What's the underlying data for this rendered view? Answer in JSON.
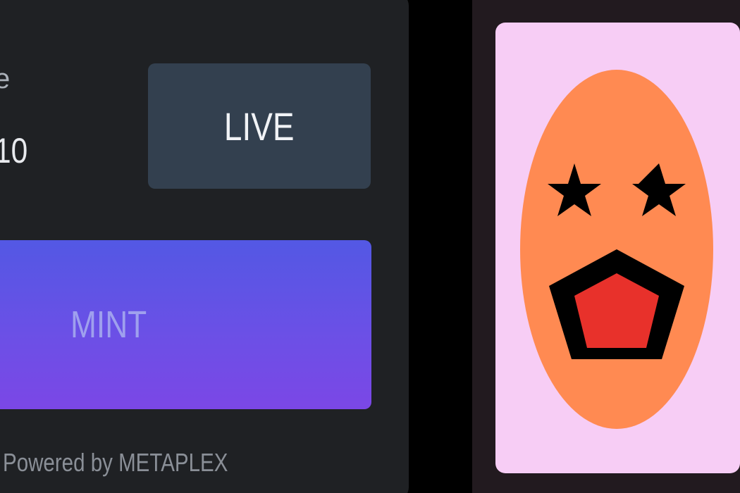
{
  "mint_panel": {
    "price_label": "ce",
    "price_value": "10",
    "status_badge": "LIVE",
    "mint_button_label": "MINT",
    "footer": "Powered by METAPLEX"
  },
  "preview": {
    "image_icon": "star-eyed-face-icon",
    "colors": {
      "background": "#f7cdf5",
      "face": "#ff8a52",
      "features": "#000000",
      "mouth_inner": "#e8312b"
    }
  },
  "colors": {
    "card_background": "#1f2124",
    "live_badge": "#33404f",
    "mint_gradient_top": "#5358e4",
    "mint_gradient_bottom": "#7b47e6"
  }
}
